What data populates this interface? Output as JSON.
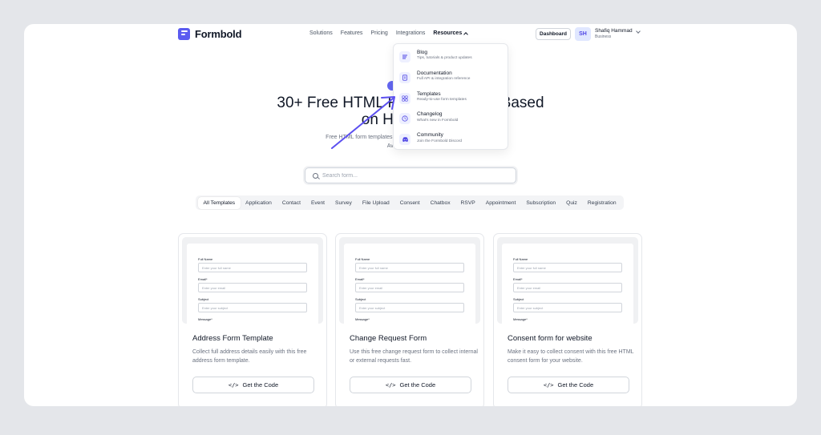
{
  "brand": {
    "name": "Formbold"
  },
  "nav": {
    "items": [
      "Solutions",
      "Features",
      "Pricing",
      "Integrations"
    ],
    "active": "Resources"
  },
  "header": {
    "dashboard_label": "Dashboard",
    "avatar_initials": "SH",
    "user_name": "Shafiq Hammad",
    "user_role": "Business"
  },
  "dropdown": {
    "items": [
      {
        "title": "Blog",
        "desc": "Tips, tutorials & product updates",
        "icon": "lines-icon"
      },
      {
        "title": "Documentation",
        "desc": "Full API & integration reference",
        "icon": "document-icon"
      },
      {
        "title": "Templates",
        "desc": "Ready-to-use form templates",
        "icon": "grid-icon"
      },
      {
        "title": "Changelog",
        "desc": "What's new in Formbold",
        "icon": "clock-icon"
      },
      {
        "title": "Community",
        "desc": "Join the Formbold Discord",
        "icon": "discord-icon"
      }
    ]
  },
  "hero": {
    "title_line1": "30+ Free HTML Form Templates Based",
    "title_line2": "on HTML/CSS",
    "sub_line1": "Free HTML form templates you can copy, paste, and use in minutes.",
    "sub_line2": "Available in HTML."
  },
  "search": {
    "placeholder": "Search form..."
  },
  "tabs": [
    "All Templates",
    "Application",
    "Contact",
    "Event",
    "Survey",
    "File Upload",
    "Consent",
    "Chatbox",
    "RSVP",
    "Appointment",
    "Subscription",
    "Quiz",
    "Registration"
  ],
  "form_preview": {
    "full_name_label": "Full Name",
    "full_name_placeholder": "Enter your full name",
    "email_label": "Email*",
    "email_placeholder": "Enter your email",
    "subject_label": "Subject",
    "subject_placeholder": "Enter your subject",
    "message_label": "Message*"
  },
  "cards": [
    {
      "title": "Address Form Template",
      "desc": "Collect full address details easily with this free address form template.",
      "button": "Get the Code"
    },
    {
      "title": "Change Request Form",
      "desc": "Use this free change request form to collect internal or external requests fast.",
      "button": "Get the Code"
    },
    {
      "title": "Consent form for website",
      "desc": "Make it easy to collect consent with this free HTML consent form for your website.",
      "button": "Get the Code"
    }
  ],
  "colors": {
    "accent": "#5b5bf0",
    "arrow": "#5b4ff0"
  }
}
